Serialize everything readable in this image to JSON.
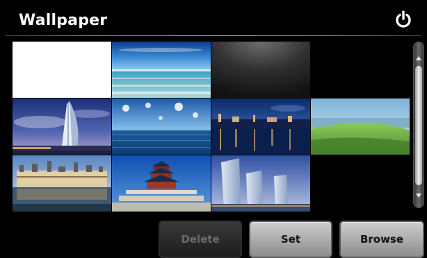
{
  "header": {
    "title": "Wallpaper",
    "power_icon": "power-icon"
  },
  "wallpapers": [
    {
      "name": "white",
      "selected": true
    },
    {
      "name": "sea-and-sky"
    },
    {
      "name": "dark-gradient"
    },
    {
      "name": "empty"
    },
    {
      "name": "burj-al-arab"
    },
    {
      "name": "clouds-over-ocean"
    },
    {
      "name": "city-at-night"
    },
    {
      "name": "green-coast"
    },
    {
      "name": "chateau"
    },
    {
      "name": "temple-of-heaven"
    },
    {
      "name": "modern-towers"
    },
    {
      "name": "empty"
    }
  ],
  "scrollbar": {
    "up_icon": "arrow-up-icon",
    "down_icon": "arrow-down-icon"
  },
  "buttons": {
    "delete_label": "Delete",
    "set_label": "Set",
    "browse_label": "Browse"
  },
  "colors": {
    "background": "#000000",
    "title": "#ffffff",
    "button_disabled_text": "#6b6b6b",
    "button_text": "#111111"
  }
}
